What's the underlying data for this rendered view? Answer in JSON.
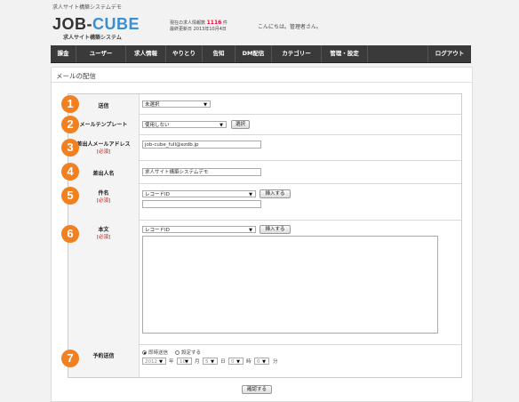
{
  "site_title": "求人サイト構築システムデモ",
  "logo": {
    "part1": "JOB-",
    "part2": "CUBE",
    "subtitle": "求人サイト構築システム"
  },
  "stats": {
    "jobs_label": "現在の求人情報数",
    "jobs_count": "1116",
    "jobs_unit": "件",
    "updated_label": "最終更新日",
    "updated_date": "2013年10月4日"
  },
  "greeting": "こんにちは。管理者さん。",
  "nav": [
    "課金",
    "ユーザー",
    "求人情報",
    "やりとり",
    "告知",
    "DM配信",
    "カテゴリー",
    "管理・設定",
    "ログアウト"
  ],
  "page_title": "メールの配信",
  "steps": [
    "1",
    "2",
    "3",
    "4",
    "5",
    "6",
    "7"
  ],
  "required_mark": "[必須]",
  "form": {
    "send": {
      "label": "送信",
      "value": "未選択"
    },
    "template": {
      "label": "メールテンプレート",
      "value": "使用しない",
      "button": "選択"
    },
    "from_address": {
      "label": "差出人メールアドレス",
      "value": "job-cube_full@ezdb.jp"
    },
    "from_name": {
      "label": "差出人名",
      "value": "求人サイト構築システムデモ"
    },
    "subject": {
      "label": "件名",
      "select": "レコードID",
      "button": "挿入する"
    },
    "body": {
      "label": "本文",
      "select": "レコードID",
      "button": "挿入する"
    },
    "schedule": {
      "label": "予約送信",
      "option_now": "即時送信",
      "option_set": "設定する",
      "selected": "即時送信",
      "year": "2012",
      "year_unit": "年",
      "month": "10",
      "month_unit": "月",
      "day": "5",
      "day_unit": "日",
      "hour": "0",
      "hour_unit": "時",
      "minute": "0",
      "minute_unit": "分"
    }
  },
  "confirm_button": "確認する"
}
